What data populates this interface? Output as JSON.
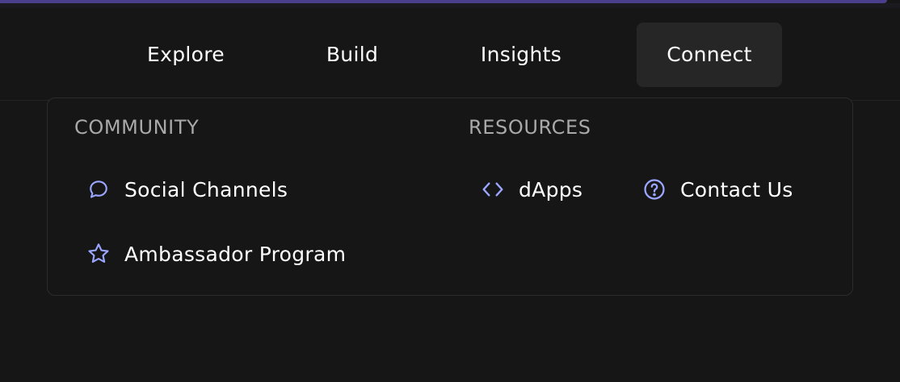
{
  "nav": {
    "items": [
      {
        "label": "Explore"
      },
      {
        "label": "Build"
      },
      {
        "label": "Insights"
      },
      {
        "label": "Connect"
      }
    ],
    "active": "Connect"
  },
  "dropdown": {
    "community": {
      "title": "COMMUNITY",
      "items": [
        {
          "label": "Social Channels",
          "icon": "chat-bubble-icon"
        },
        {
          "label": "Ambassador Program",
          "icon": "star-icon"
        }
      ]
    },
    "resources": {
      "title": "RESOURCES",
      "items": [
        {
          "label": "dApps",
          "icon": "code-icon"
        },
        {
          "label": "Contact Us",
          "icon": "question-circle-icon"
        }
      ]
    }
  },
  "colors": {
    "background": "#161616",
    "active_tab": "#262626",
    "icon_accent": "#9aa6ff",
    "section_title": "#a9a9a9",
    "top_accent": "#4a3f8c"
  }
}
